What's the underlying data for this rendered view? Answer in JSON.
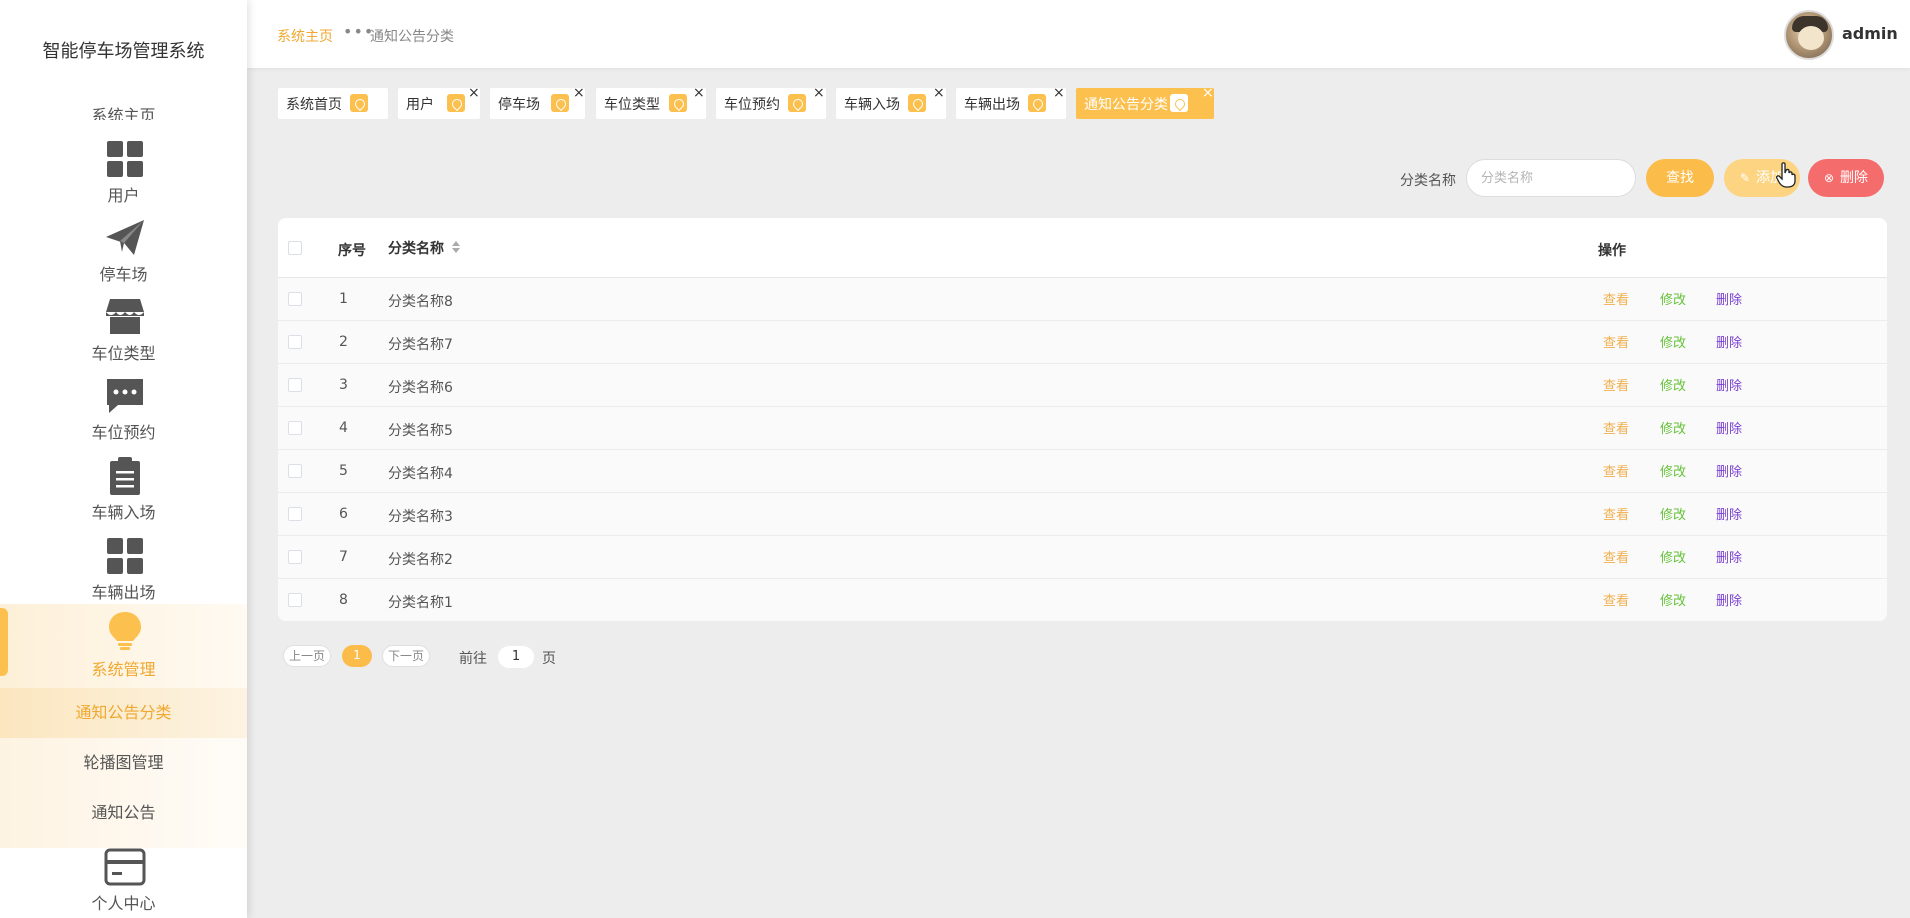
{
  "sidebar": {
    "system_title": "智能停车场管理系统",
    "cut_item": "系统主页",
    "items": [
      {
        "label": "用户",
        "icon": "grid-icon"
      },
      {
        "label": "停车场",
        "icon": "paper-plane-icon"
      },
      {
        "label": "车位类型",
        "icon": "storefront-icon"
      },
      {
        "label": "车位预约",
        "icon": "chat-bubble-icon"
      },
      {
        "label": "车辆入场",
        "icon": "clipboard-icon"
      },
      {
        "label": "车辆出场",
        "icon": "grid-icon"
      },
      {
        "label": "系统管理",
        "icon": "lightbulb-icon"
      },
      {
        "label": "个人中心",
        "icon": "credit-card-icon"
      }
    ],
    "submenu": [
      "通知公告分类",
      "轮播图管理",
      "通知公告"
    ]
  },
  "header": {
    "breadcrumb_home": "系统主页",
    "breadcrumb_separator": "•••",
    "breadcrumb_current": "通知公告分类",
    "username": "admin"
  },
  "tags": [
    {
      "label": "系统首页"
    },
    {
      "label": "用户"
    },
    {
      "label": "停车场"
    },
    {
      "label": "车位类型"
    },
    {
      "label": "车位预约"
    },
    {
      "label": "车辆入场"
    },
    {
      "label": "车辆出场"
    },
    {
      "label": "通知公告分类"
    }
  ],
  "tag_close": "×",
  "search": {
    "label": "分类名称",
    "placeholder": "分类名称",
    "search_button": "查找",
    "add_button": "添加",
    "delete_button": "删除"
  },
  "table": {
    "headers": {
      "index": "序号",
      "name": "分类名称",
      "actions": "操作"
    },
    "rows": [
      {
        "index": "1",
        "name": "分类名称8"
      },
      {
        "index": "2",
        "name": "分类名称7"
      },
      {
        "index": "3",
        "name": "分类名称6"
      },
      {
        "index": "4",
        "name": "分类名称5"
      },
      {
        "index": "5",
        "name": "分类名称4"
      },
      {
        "index": "6",
        "name": "分类名称3"
      },
      {
        "index": "7",
        "name": "分类名称2"
      },
      {
        "index": "8",
        "name": "分类名称1"
      }
    ],
    "actions": {
      "view": "查看",
      "edit": "修改",
      "delete": "删除"
    }
  },
  "pagination": {
    "prev": "上一页",
    "current": "1",
    "next": "下一页",
    "goto_label": "前往",
    "goto_value": "1",
    "unit": "页"
  },
  "colors": {
    "accent": "#fbc04e",
    "danger": "#f56c6c",
    "view": "#f0b050",
    "edit": "#67c23a",
    "delete": "#7a3fd1"
  }
}
